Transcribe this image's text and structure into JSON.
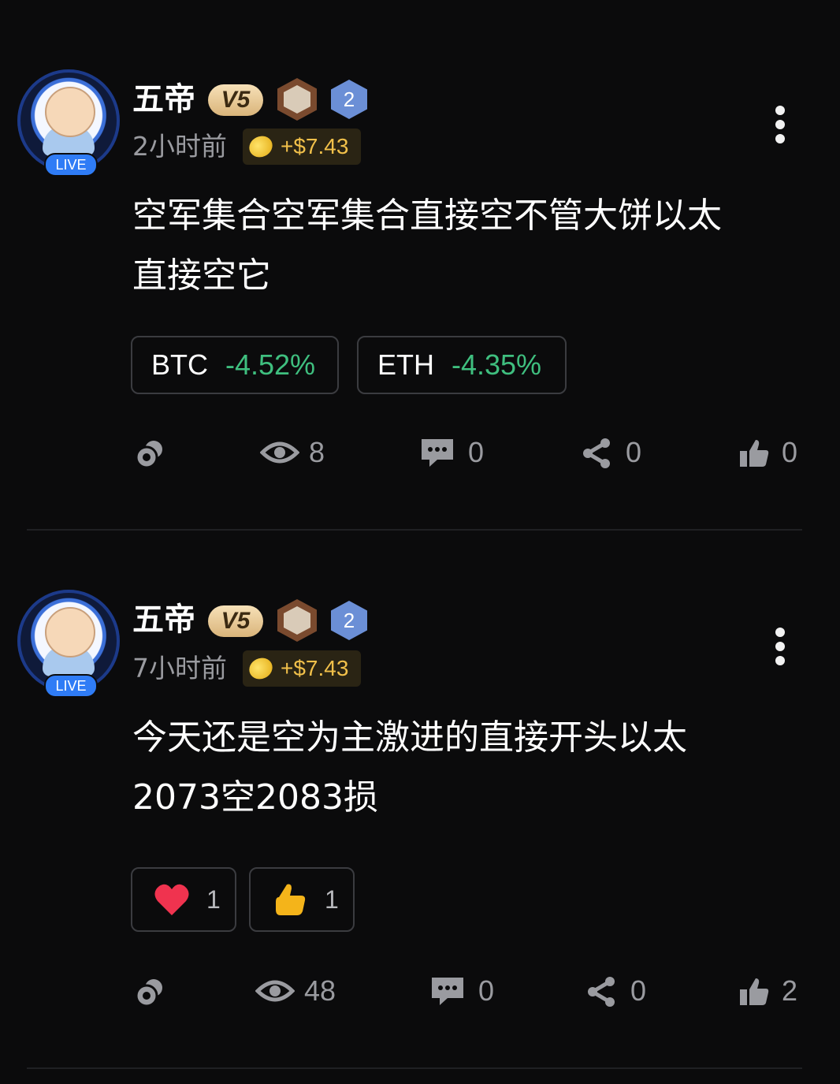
{
  "posts": [
    {
      "author": "五帝",
      "vip": "V5",
      "level": "2",
      "live": "LIVE",
      "time": "2小时前",
      "tip": "+$7.43",
      "content": [
        "空军集合空军集合直接空不管大饼以太",
        "直接空它"
      ],
      "tags": [
        {
          "symbol": "BTC",
          "change": "-4.52%"
        },
        {
          "symbol": "ETH",
          "change": "-4.35%"
        }
      ],
      "stats": {
        "views": "8",
        "comments": "0",
        "shares": "0",
        "likes": "0"
      }
    },
    {
      "author": "五帝",
      "vip": "V5",
      "level": "2",
      "live": "LIVE",
      "time": "7小时前",
      "tip": "+$7.43",
      "content": [
        "今天还是空为主激进的直接开头以太",
        "2073空2083损"
      ],
      "reactions": [
        {
          "icon": "heart-icon",
          "count": "1"
        },
        {
          "icon": "thumbs-up-icon",
          "count": "1"
        }
      ],
      "stats": {
        "views": "48",
        "comments": "0",
        "shares": "0",
        "likes": "2"
      }
    }
  ],
  "colors": {
    "background": "#0b0b0c",
    "positive_green": "#3fbf7f",
    "tip_gold": "#f1c04a",
    "live_blue": "#2f7cf6"
  }
}
